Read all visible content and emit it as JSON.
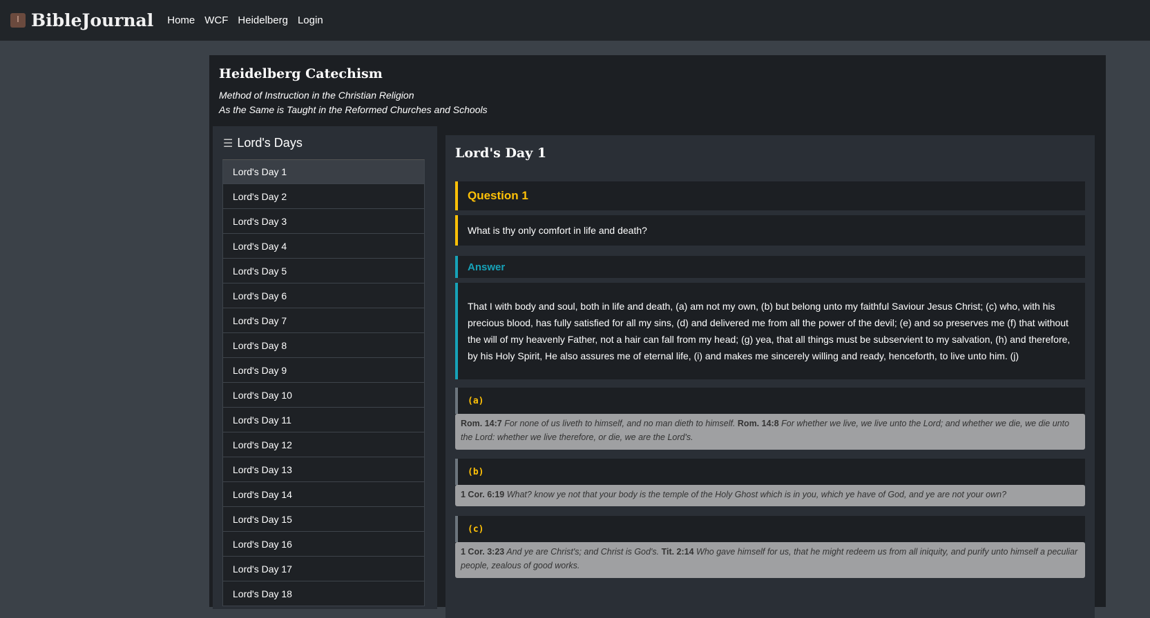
{
  "nav": {
    "brand": "BibleJournal",
    "links": [
      "Home",
      "WCF",
      "Heidelberg",
      "Login"
    ]
  },
  "page": {
    "title": "Heidelberg Catechism",
    "subtitle1": "Method of Instruction in the Christian Religion",
    "subtitle2": "As the Same is Taught in the Reformed Churches and Schools"
  },
  "sidebar": {
    "heading": "Lord's Days",
    "items": [
      "Lord's Day 1",
      "Lord's Day 2",
      "Lord's Day 3",
      "Lord's Day 4",
      "Lord's Day 5",
      "Lord's Day 6",
      "Lord's Day 7",
      "Lord's Day 8",
      "Lord's Day 9",
      "Lord's Day 10",
      "Lord's Day 11",
      "Lord's Day 12",
      "Lord's Day 13",
      "Lord's Day 14",
      "Lord's Day 15",
      "Lord's Day 16",
      "Lord's Day 17",
      "Lord's Day 18"
    ]
  },
  "main": {
    "day_title": "Lord's Day 1",
    "question_label": "Question 1",
    "question": "What is thy only comfort in life and death?",
    "answer_label": "Answer",
    "answer": "That I with body and soul, both in life and death, (a) am not my own, (b) but belong unto my faithful Saviour Jesus Christ; (c) who, with his precious blood, has fully satisfied for all my sins, (d) and delivered me from all the power of the devil; (e) and so preserves me (f) that without the will of my heavenly Father, not a hair can fall from my head; (g) yea, that all things must be subservient to my salvation, (h) and therefore, by his Holy Spirit, He also assures me of eternal life, (i) and makes me sincerely willing and ready, henceforth, to live unto him. (j)",
    "refs": [
      {
        "label": "(a)",
        "parts": [
          {
            "ref": "Rom. 14:7",
            "text": " For none of us liveth to himself, and no man dieth to himself. "
          },
          {
            "ref": "Rom. 14:8",
            "text": " For whether we live, we live unto the Lord; and whether we die, we die unto the Lord: whether we live therefore, or die, we are the Lord's."
          }
        ]
      },
      {
        "label": "(b)",
        "parts": [
          {
            "ref": "1 Cor. 6:19",
            "text": " What? know ye not that your body is the temple of the Holy Ghost which is in you, which ye have of God, and ye are not your own?"
          }
        ]
      },
      {
        "label": "(c)",
        "parts": [
          {
            "ref": "1 Cor. 3:23",
            "text": " And ye are Christ's; and Christ is God's. "
          },
          {
            "ref": "Tit. 2:14",
            "text": " Who gave himself for us, that he might redeem us from all iniquity, and purify unto himself a peculiar people, zealous of good works."
          }
        ]
      }
    ]
  }
}
